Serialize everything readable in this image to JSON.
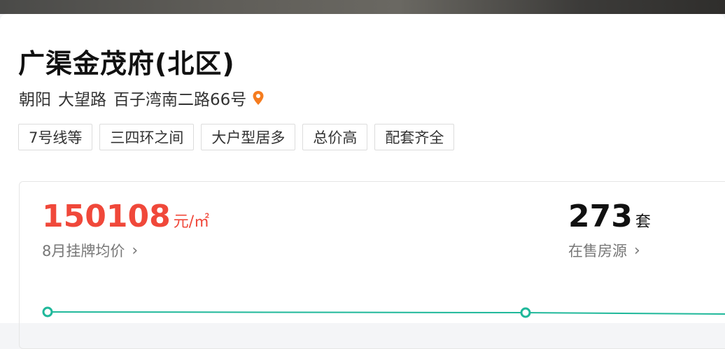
{
  "property": {
    "name": "广渠金茂府(北区)",
    "address": {
      "district": "朝阳",
      "area": "大望路",
      "street": "百子湾南二路66号"
    },
    "tags": [
      "7号线等",
      "三四环之间",
      "大户型居多",
      "总价高",
      "配套齐全"
    ]
  },
  "stats": {
    "price": {
      "value": "150108",
      "unit": "元/㎡",
      "label": "8月挂牌均价",
      "chevron": "›"
    },
    "listings": {
      "value": "273",
      "unit": "套",
      "label": "在售房源",
      "chevron": "›"
    }
  },
  "colors": {
    "price_red": "#f0483a",
    "pin_orange": "#f57c1f",
    "trend_teal": "#1fb89a"
  },
  "icons": {
    "location": "location-pin-icon",
    "chevron": "chevron-right-icon"
  }
}
